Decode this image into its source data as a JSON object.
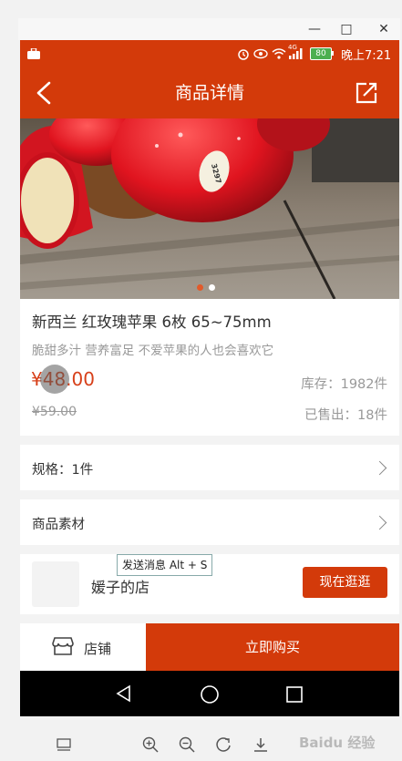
{
  "window": {
    "minimize_glyph": "—",
    "maximize_glyph": "□",
    "close_glyph": "✕"
  },
  "statusbar": {
    "signal_label": "4G",
    "battery": "80",
    "time": "晚上7:21"
  },
  "appbar": {
    "title": "商品详情"
  },
  "product": {
    "title": "新西兰 红玫瑰苹果 6枚 65~75mm",
    "subtitle": "脆甜多汁 营养富足 不爱苹果的人也会喜欢它",
    "price": "¥48.00",
    "original_price": "¥59.00",
    "stock": "库存：1982件",
    "sold": "已售出：18件",
    "apple_sticker": "3297"
  },
  "carousel": {
    "active_index": 0,
    "count": 2
  },
  "rows": {
    "spec": "规格：1件",
    "material": "商品素材"
  },
  "shop": {
    "name": "媛子的店",
    "visit_button": "现在逛逛",
    "tooltip": "发送消息 Alt + S"
  },
  "bottombar": {
    "store_label": "店铺",
    "buy_label": "立即购买"
  },
  "watermark": "Baidu 经验",
  "colors": {
    "brand": "#d33a0a",
    "price": "#d7401a"
  }
}
